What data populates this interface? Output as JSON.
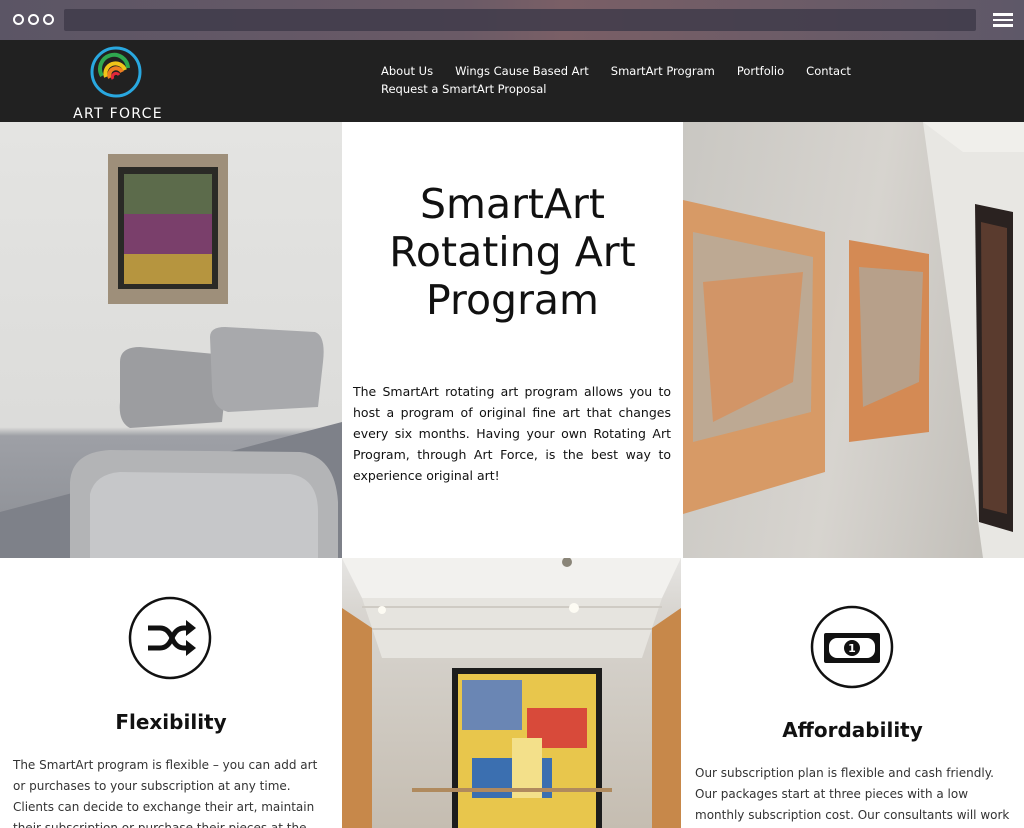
{
  "site": {
    "logo_text": "ART FORCE"
  },
  "nav": {
    "items": [
      {
        "label": "About Us"
      },
      {
        "label": "Wings Cause Based Art"
      },
      {
        "label": "SmartArt Program"
      },
      {
        "label": "Portfolio"
      },
      {
        "label": "Contact"
      },
      {
        "label": "Request a SmartArt Proposal"
      }
    ]
  },
  "hero": {
    "title_lines": [
      "SmartArt",
      "Rotating Art",
      "Program"
    ],
    "description": "The SmartArt rotating art program allows you to host a program of original fine art that changes every six months. Having your own Rotating Art Program, through Art Force, is the best way to experience original art!"
  },
  "features": {
    "flexibility": {
      "icon": "shuffle-icon",
      "title": "Flexibility",
      "text": "The SmartArt program is flexible – you can add art or purchases to your subscription at any time. Clients can decide to exchange their art, maintain their subscription or purchase their pieces at the end of their term. Any"
    },
    "affordability": {
      "icon": "money-icon",
      "title": "Affordability",
      "text": "Our subscription plan is flexible and cash friendly. Our packages start at three pieces with a low monthly subscription cost. Our consultants will work with you to"
    }
  },
  "colors": {
    "header_bg": "#212121",
    "chrome_bg": "#5e5868"
  }
}
